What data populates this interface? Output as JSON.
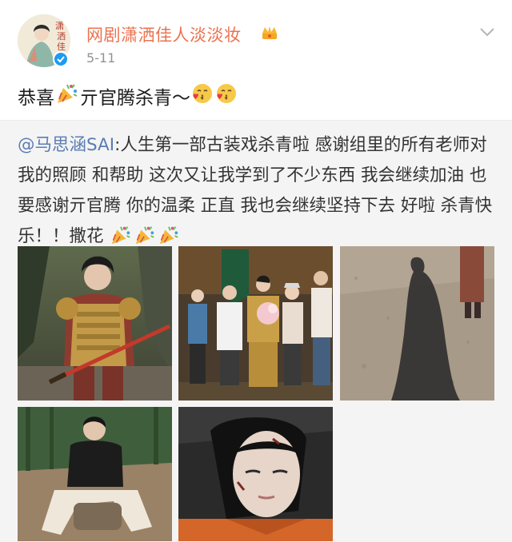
{
  "post": {
    "username": "网剧潇洒佳人淡淡妆",
    "timestamp": "5-11",
    "text_before": "恭喜",
    "text_after": "亓官腾杀青～",
    "icons": {
      "avatar": "avatar-illustration",
      "verified": "verified-badge-icon",
      "vip": "crown-icon",
      "menu": "chevron-down-icon",
      "party": "party-popper-emoji",
      "kiss": "kissing-face-emoji"
    },
    "colors": {
      "username": "#eb7350",
      "mention": "#5a7db3",
      "verified": "#1d9bf0"
    }
  },
  "repost": {
    "mention": "@马思涵SAI",
    "body": ":人生第一部古装戏杀青啦 感谢组里的所有老师对我的照顾 和帮助 这次又让我学到了不少东西 我会继续加油 也要感谢亓官腾 你的温柔 正直 我也会继续坚持下去 好啦 杀青快乐！！撒花",
    "photo_count": 5
  }
}
